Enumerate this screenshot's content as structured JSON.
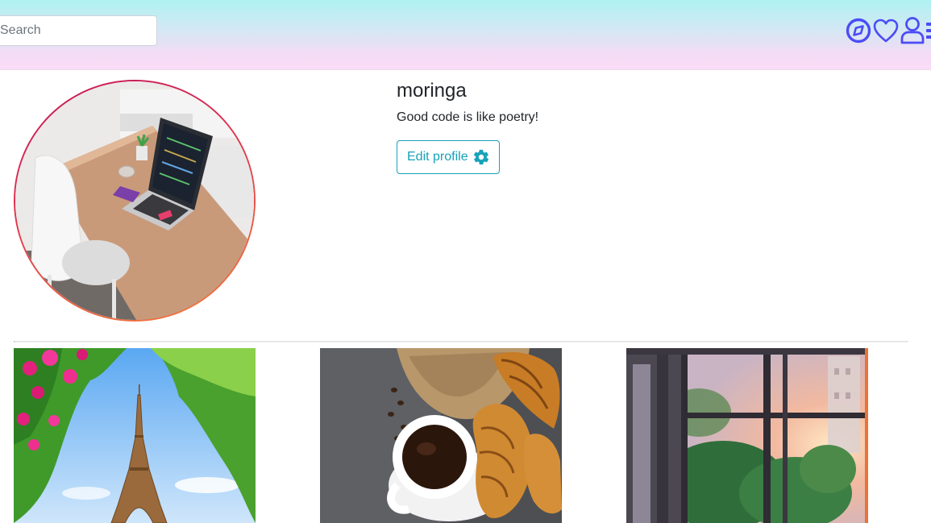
{
  "search": {
    "placeholder": "Search"
  },
  "nav": {
    "icons": [
      "compass-icon",
      "heart-icon",
      "user-icon",
      "list-icon"
    ],
    "accent_color": "#4c4cf5"
  },
  "profile": {
    "username": "moringa",
    "bio": "Good code is like poetry!",
    "edit_button_label": "Edit profile",
    "edit_button_icon": "gear-icon",
    "button_color": "#17a2b8",
    "avatar_ring_colors": [
      "#c3135a",
      "#f3803d"
    ]
  },
  "posts": [
    {
      "subject": "eiffel-tower-photo"
    },
    {
      "subject": "coffee-croissants-photo"
    },
    {
      "subject": "window-sunlight-photo"
    }
  ]
}
